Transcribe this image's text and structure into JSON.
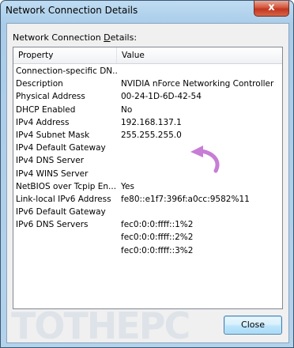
{
  "window": {
    "title": "Network Connection Details",
    "close_glyph": "x"
  },
  "section_label": {
    "before": "Network Connection ",
    "underlined": "D",
    "after": "etails:"
  },
  "table": {
    "columns": [
      "Property",
      "Value"
    ],
    "rows": [
      [
        "Connection-specific DN...",
        ""
      ],
      [
        "Description",
        "NVIDIA nForce Networking Controller"
      ],
      [
        "Physical Address",
        "00-24-1D-6D-42-54"
      ],
      [
        "DHCP Enabled",
        "No"
      ],
      [
        "IPv4 Address",
        "192.168.137.1"
      ],
      [
        "IPv4 Subnet Mask",
        "255.255.255.0"
      ],
      [
        "IPv4 Default Gateway",
        ""
      ],
      [
        "IPv4 DNS Server",
        ""
      ],
      [
        "IPv4 WINS Server",
        ""
      ],
      [
        "NetBIOS over Tcpip En...",
        "Yes"
      ],
      [
        "Link-local IPv6 Address",
        "fe80::e1f7:396f:a0cc:9582%11"
      ],
      [
        "IPv6 Default Gateway",
        ""
      ],
      [
        "IPv6 DNS Servers",
        "fec0:0:0:ffff::1%2"
      ],
      [
        "",
        "fec0:0:0:ffff::2%2"
      ],
      [
        "",
        "fec0:0:0:ffff::3%2"
      ]
    ]
  },
  "buttons": {
    "close_label": "Close"
  },
  "watermark": "TOTHEPC",
  "colors": {
    "arrow": "#c77dd6",
    "window_frame": "#b3d3ec",
    "close_button": "#c1361e"
  },
  "icons": {
    "annotation": "curved-arrow-icon",
    "title_close": "close-icon"
  }
}
